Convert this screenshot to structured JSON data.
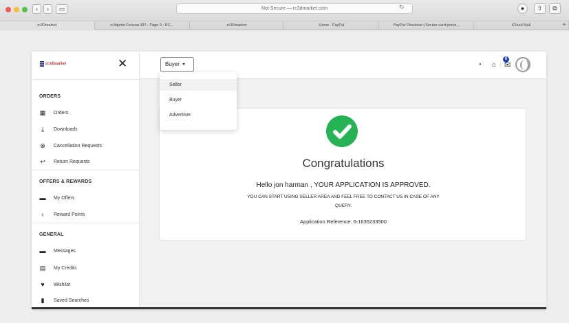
{
  "browser": {
    "url": "Not Secure — rc3dmarket.com",
    "tabs": [
      "rc3Dmarket",
      "rc3dprint Cessna 337 - Page 9 - RC...",
      "rc3Dmarket",
      "Home - PayPal",
      "PayPal Checkout | Secure card proce...",
      "iCloud Mail"
    ],
    "active_tab": 0,
    "new_tab": "+"
  },
  "logo": {
    "text": "rc3dmarket"
  },
  "sidebar": {
    "sections": [
      {
        "heading": "ORDERS",
        "items": [
          {
            "icon": "box-icon",
            "label": "Orders"
          },
          {
            "icon": "download-icon",
            "label": "Downloads"
          },
          {
            "icon": "cancel-circle-icon",
            "label": "Cancellation Requests"
          },
          {
            "icon": "return-arrow-icon",
            "label": "Return Requests"
          }
        ]
      },
      {
        "heading": "OFFERS & REWARDS",
        "items": [
          {
            "icon": "offer-tag-icon",
            "label": "My Offers"
          },
          {
            "icon": "reward-medal-icon",
            "label": "Reward Points"
          }
        ]
      },
      {
        "heading": "GENERAL",
        "items": [
          {
            "icon": "message-icon",
            "label": "Messages"
          },
          {
            "icon": "credit-card-icon",
            "label": "My Credits"
          },
          {
            "icon": "heart-icon",
            "label": "Wishlist"
          },
          {
            "icon": "bookmark-icon",
            "label": "Saved Searches"
          }
        ]
      }
    ]
  },
  "topbar": {
    "role_select": "Buyer",
    "dropdown_options": [
      "Seller",
      "Buyer",
      "Advertiser"
    ],
    "hovered_option": "Seller",
    "notification_count": "0"
  },
  "card": {
    "title": "Congratulations",
    "message": "Hello jon harman , YOUR APPLICATION IS APPROVED.",
    "note_line1": "YOU CAN START USING SELLER AREA AND FEEL FREE TO CONTACT US IN CASE OF ANY",
    "note_line2": "QUERY.",
    "reference": "Application Reference: 6-1635233500"
  },
  "colors": {
    "success": "#26b356",
    "brand_red": "#c0262c",
    "brand_blue": "#2a3990"
  }
}
